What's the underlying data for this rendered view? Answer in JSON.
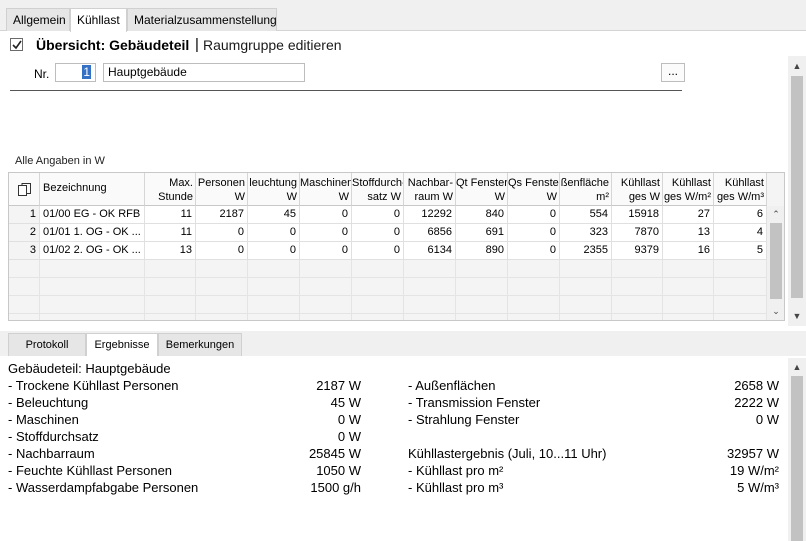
{
  "tabs": [
    "Allgemein",
    "Kühllast",
    "Materialzusammenstellung"
  ],
  "header": {
    "title": "Übersicht: Gebäudeteil",
    "separator": "|",
    "link": "Raumgruppe editieren"
  },
  "form": {
    "nr_label": "Nr.",
    "nr_value": "1",
    "name_value": "Hauptgebäude",
    "dots_label": "..."
  },
  "note": "Alle Angaben in W",
  "table": {
    "columns": [
      {
        "l1": "",
        "l2": "Bezeichnung"
      },
      {
        "l1": "Max.",
        "l2": "Stunde"
      },
      {
        "l1": "Personen",
        "l2": "W"
      },
      {
        "l1": "leuchtung",
        "l2": "W"
      },
      {
        "l1": "Maschinen",
        "l2": "W"
      },
      {
        "l1": "Stoffdurch-",
        "l2": "satz W"
      },
      {
        "l1": "Nachbar-",
        "l2": "raum W"
      },
      {
        "l1": "Qt Fenster",
        "l2": "W"
      },
      {
        "l1": "Qs Fenster",
        "l2": "W"
      },
      {
        "l1": "ßenfläche",
        "l2": "m²"
      },
      {
        "l1": "Kühllast",
        "l2": "ges W"
      },
      {
        "l1": "Kühllast",
        "l2": "ges W/m²"
      },
      {
        "l1": "Kühllast",
        "l2": "ges W/m³"
      }
    ],
    "rows": [
      [
        "1",
        "01/00 EG - OK RFB",
        "11",
        "2187",
        "45",
        "0",
        "0",
        "12292",
        "840",
        "0",
        "554",
        "15918",
        "27",
        "6"
      ],
      [
        "2",
        "01/01 1. OG - OK ...",
        "11",
        "0",
        "0",
        "0",
        "0",
        "6856",
        "691",
        "0",
        "323",
        "7870",
        "13",
        "4"
      ],
      [
        "3",
        "01/02 2. OG - OK ...",
        "13",
        "0",
        "0",
        "0",
        "0",
        "6134",
        "890",
        "0",
        "2355",
        "9379",
        "16",
        "5"
      ]
    ]
  },
  "bottom_tabs": [
    "Protokoll",
    "Ergebnisse",
    "Bemerkungen"
  ],
  "results": {
    "title": "Gebäudeteil: Hauptgebäude",
    "left": [
      {
        "label": "- Trockene Kühllast Personen",
        "value": "2187 W"
      },
      {
        "label": "- Beleuchtung",
        "value": "45 W"
      },
      {
        "label": "- Maschinen",
        "value": "0 W"
      },
      {
        "label": "- Stoffdurchsatz",
        "value": "0 W"
      },
      {
        "label": "- Nachbarraum",
        "value": "25845 W"
      },
      {
        "label": "- Feuchte Kühllast Personen",
        "value": "1050 W"
      },
      {
        "label": "- Wasserdampfabgabe Personen",
        "value": "1500 g/h"
      }
    ],
    "right": [
      {
        "label": "- Außenflächen",
        "value": "2658 W"
      },
      {
        "label": "- Transmission Fenster",
        "value": "2222 W"
      },
      {
        "label": "- Strahlung Fenster",
        "value": "0 W"
      },
      {
        "label": "",
        "value": ""
      },
      {
        "label": "Kühllastergebnis (Juli, 10...11 Uhr)",
        "value": "32957 W"
      },
      {
        "label": "- Kühllast pro m²",
        "value": "19 W/m²"
      },
      {
        "label": "- Kühllast pro m³",
        "value": "5 W/m³"
      }
    ]
  }
}
